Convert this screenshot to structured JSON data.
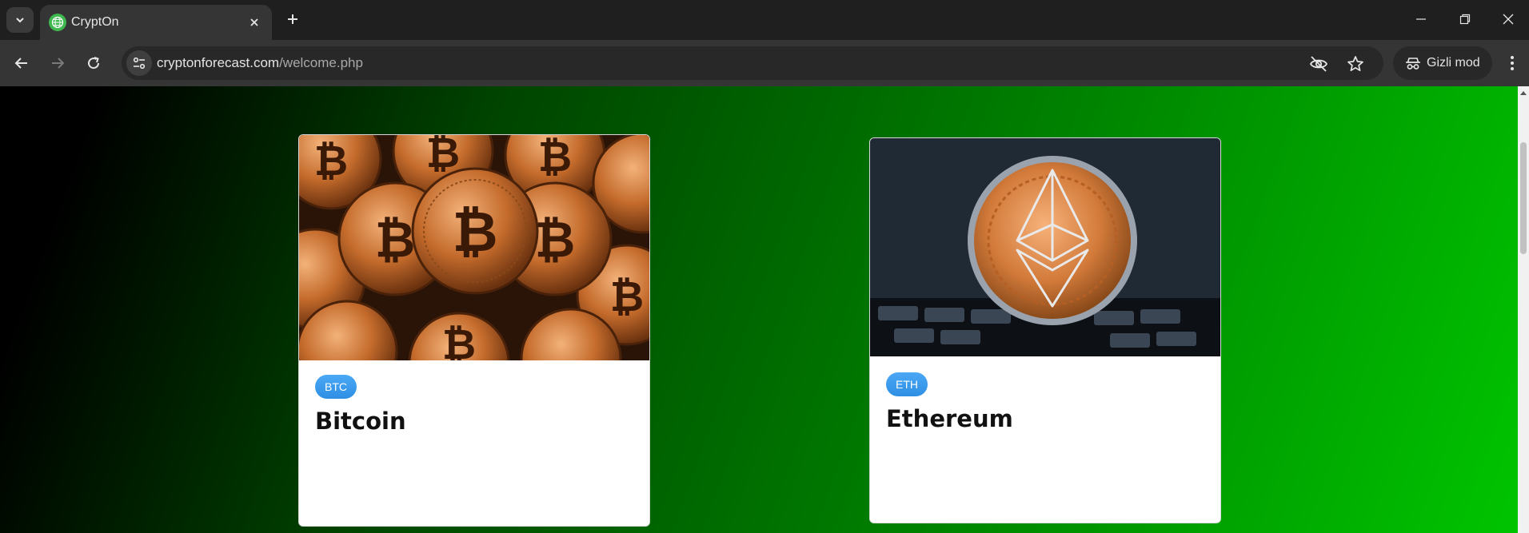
{
  "browser": {
    "tab": {
      "title": "CryptOn"
    },
    "address_bar": {
      "domain": "cryptonforecast.com",
      "path": "/welcome.php"
    },
    "profile": {
      "label": "Gizli mod"
    }
  },
  "page": {
    "cards": [
      {
        "symbol": "BTC",
        "name": "Bitcoin"
      },
      {
        "symbol": "ETH",
        "name": "Ethereum"
      }
    ]
  },
  "colors": {
    "badge": "#3d9cf0",
    "gradient_start": "#000000",
    "gradient_end": "#00c400"
  }
}
